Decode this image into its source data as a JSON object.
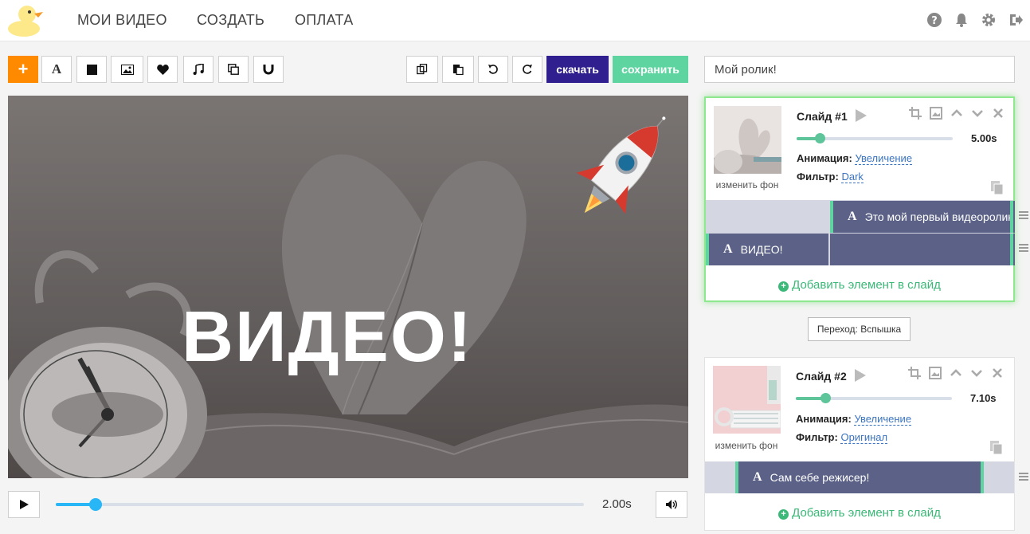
{
  "nav": {
    "items": [
      "МОИ ВИДЕО",
      "СОЗДАТЬ",
      "ОПЛАТА"
    ],
    "icons": [
      "help-icon",
      "bell-icon",
      "gear-icon",
      "logout-icon"
    ]
  },
  "toolbar": {
    "add_label": "+",
    "text_tool": "A",
    "download_label": "скачать",
    "save_label": "сохранить",
    "colors": {
      "add": "#ff8a00",
      "download": "#2f1f8f",
      "save": "#5ed5a0"
    }
  },
  "project": {
    "title": "Мой ролик!"
  },
  "preview": {
    "text": "ВИДЕО!"
  },
  "player": {
    "time": "2.00s",
    "progress": 0.075
  },
  "slides": [
    {
      "name": "Слайд #1",
      "duration": "5.00s",
      "duration_fraction": 0.15,
      "animation_label": "Анимация:",
      "animation": "Увеличение",
      "filter_label": "Фильтр:",
      "filter": "Dark",
      "change_bg": "изменить фон",
      "layers": [
        "Это мой первый видеоролик",
        "ВИДЕО!"
      ],
      "add_element": "Добавить элемент в слайд"
    },
    {
      "name": "Слайд #2",
      "duration": "7.10s",
      "duration_fraction": 0.19,
      "animation_label": "Анимация:",
      "animation": "Увеличение",
      "filter_label": "Фильтр:",
      "filter": "Оригинал",
      "change_bg": "изменить фон",
      "layers": [
        "Сам себе режисер!"
      ],
      "add_element": "Добавить элемент в слайд"
    }
  ],
  "transition": {
    "label": "Переход: Вспышка"
  }
}
